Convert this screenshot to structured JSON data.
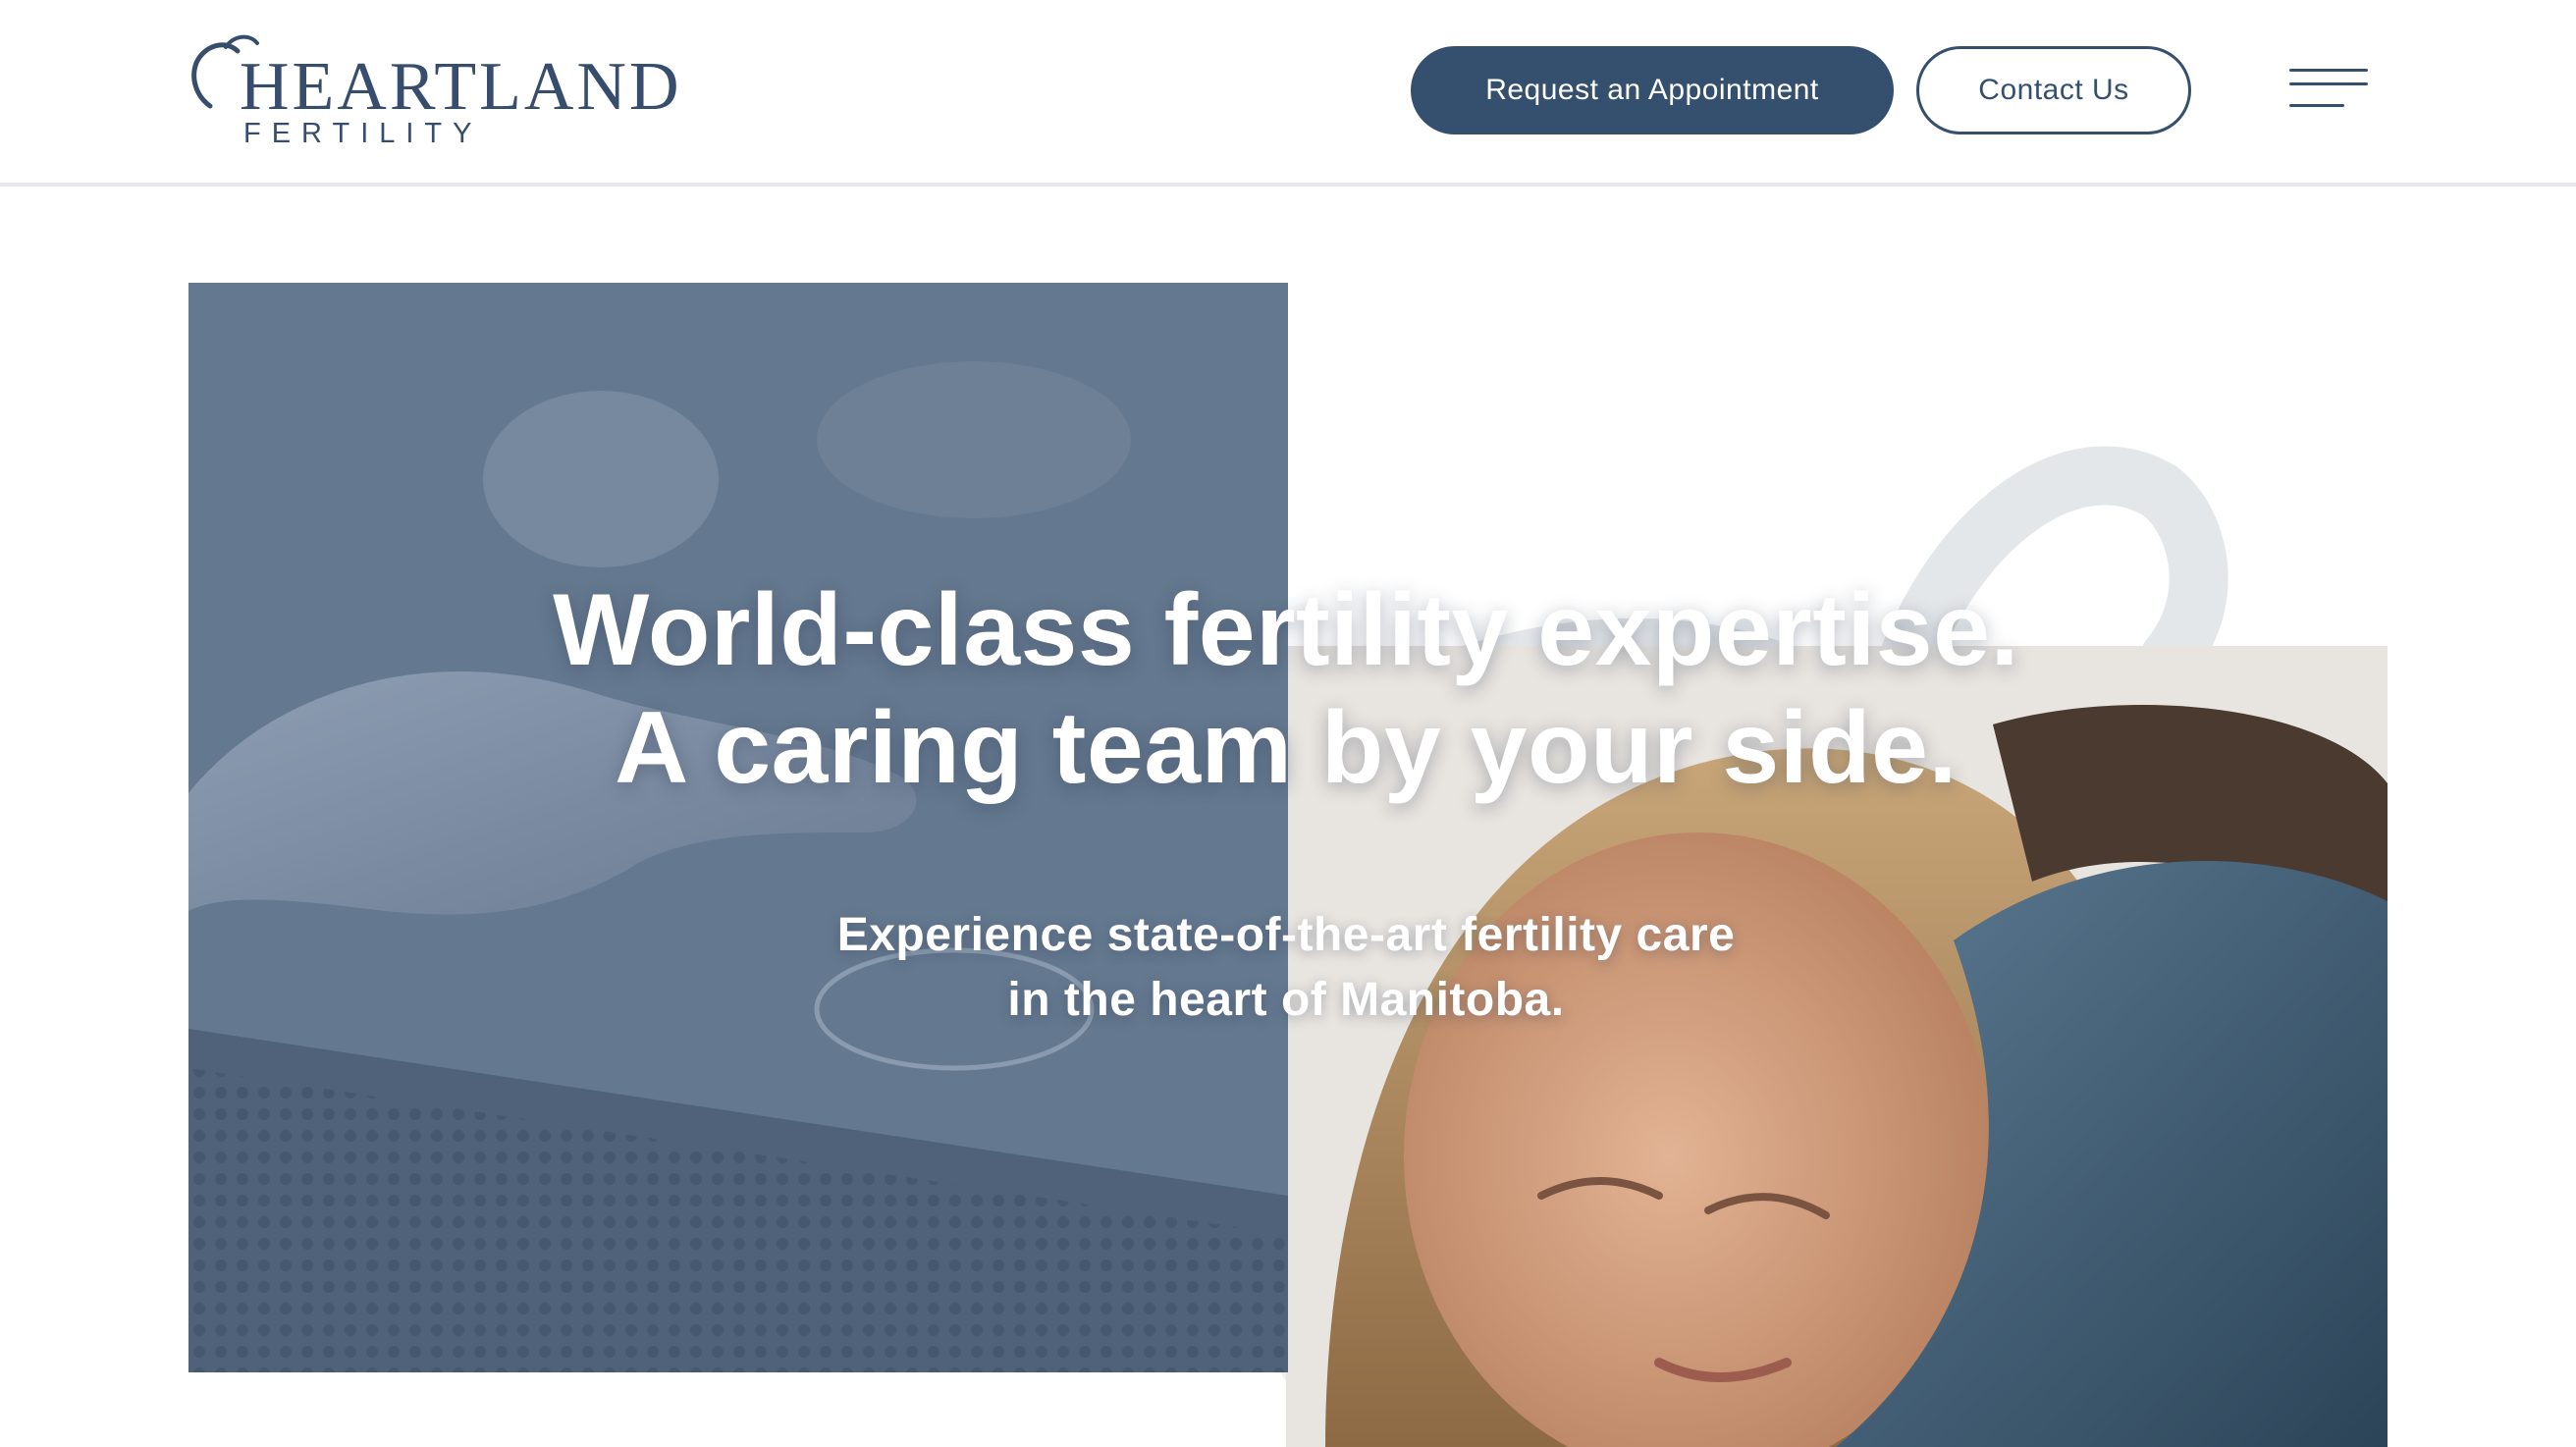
{
  "header": {
    "logo": {
      "wordmark": "HEARTLAND",
      "subline": "FERTILITY"
    },
    "buttons": {
      "appointment": "Request an Appointment",
      "contact": "Contact Us"
    },
    "menu_icon": "hamburger-menu-icon"
  },
  "hero": {
    "title_lines": [
      "World-class fertility expertise.",
      "A caring team by your side."
    ],
    "subtitle_lines": [
      "Experience state-of-the-art fertility care",
      "in the heart of Manitoba."
    ],
    "images": {
      "lab": "lab-gloved-hand-petri-dish-photo",
      "couple": "couple-embracing-photo"
    }
  },
  "colors": {
    "brand_navy": "#354f6f",
    "lab_overlay": "#62768f",
    "arc_grey": "#e4e7ea",
    "header_border": "#e6e8eb"
  }
}
